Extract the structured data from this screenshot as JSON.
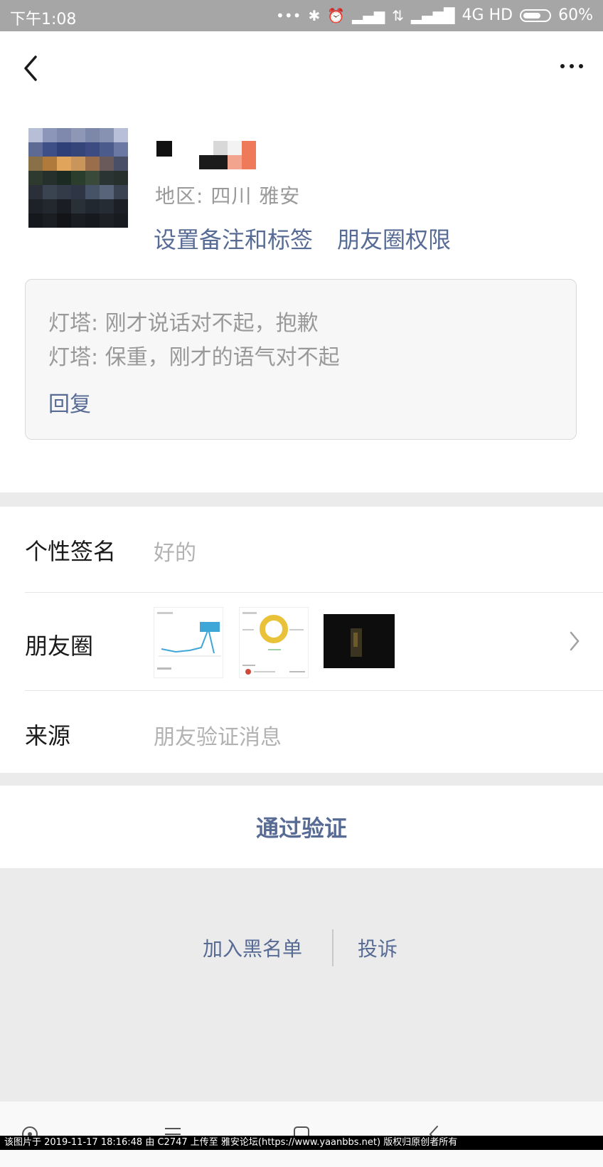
{
  "status_bar": {
    "time": "下午1:08",
    "network": "4G HD",
    "battery": "60%"
  },
  "header": {
    "back_icon": "back-chevron-icon",
    "more_icon": "more-dots-icon"
  },
  "profile": {
    "region": "地区: 四川  雅安",
    "set_remark": "设置备注和标签",
    "moments_permission": "朋友圈权限"
  },
  "messages": {
    "lines": [
      "灯塔: 刚才说话对不起，抱歉",
      "灯塔: 保重，刚才的语气对不起"
    ],
    "reply": "回复"
  },
  "info_rows": {
    "signature_label": "个性签名",
    "signature_value": "好的",
    "moments_label": "朋友圈",
    "source_label": "来源",
    "source_value": "朋友验证消息"
  },
  "actions": {
    "verify": "通过验证",
    "blacklist": "加入黑名单",
    "report": "投诉"
  },
  "footer": {
    "watermark": "该图片于 2019-11-17 18:16:48 由 C2747 上传至 雅安论坛(https://www.yaanbbs.net) 版权归原创者所有"
  },
  "colors": {
    "link": "#576b95",
    "status_bar": "#a6a6a6",
    "page_bg": "#ebebeb"
  }
}
